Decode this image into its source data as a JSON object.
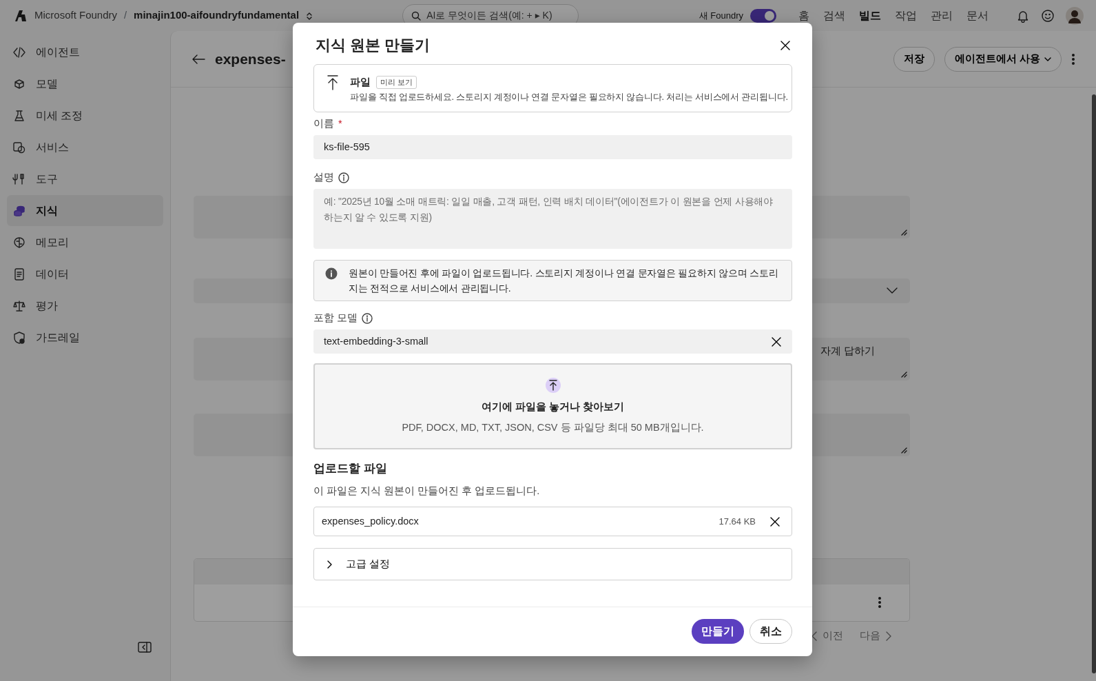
{
  "top_bar": {
    "brand": "Microsoft Foundry",
    "separator": "/",
    "project": "minajin100-aifoundryfundamental",
    "search": {
      "placeholder": "AI로 무엇이든 검색(예: + ▸ K)"
    },
    "new_foundry_toggle": {
      "label": "새 Foundry",
      "on": true
    },
    "nav": [
      {
        "label": "홈",
        "selected": false
      },
      {
        "label": "검색",
        "selected": false
      },
      {
        "label": "빌드",
        "selected": true
      },
      {
        "label": "작업",
        "selected": false
      },
      {
        "label": "관리",
        "selected": false
      },
      {
        "label": "문서",
        "selected": false
      }
    ]
  },
  "sidebar": {
    "items": [
      {
        "label": "에이전트",
        "selected": false
      },
      {
        "label": "모델",
        "selected": false
      },
      {
        "label": "미세 조정",
        "selected": false
      },
      {
        "label": "서비스",
        "selected": false
      },
      {
        "label": "도구",
        "selected": false
      },
      {
        "label": "지식",
        "selected": true
      },
      {
        "label": "메모리",
        "selected": false
      },
      {
        "label": "데이터",
        "selected": false
      },
      {
        "label": "평가",
        "selected": false
      },
      {
        "label": "가드레일",
        "selected": false
      }
    ]
  },
  "page": {
    "title": "expenses-",
    "buttons": [
      "저장",
      "에이전트에서 사용"
    ],
    "visible_field_text": "자계 답하기",
    "pagination": {
      "previous": "이전",
      "next": "다음"
    }
  },
  "dialog": {
    "title": "지식 원본 만들기",
    "source_type": {
      "title": "파일",
      "badge": "미리 보기",
      "description": "파일을 직접 업로드하세요. 스토리지 계정이나 연결 문자열은 필요하지 않습니다. 처리는 서비스에서 관리됩니다."
    },
    "name_field": {
      "label": "이름",
      "required": true,
      "required_mark": "*",
      "value": "ks-file-595"
    },
    "description_field": {
      "label": "설명",
      "placeholder": "예: \"2025년 10월 소매 매트릭: 일일 매출, 고객 패턴, 인력 배치 데이터\"(에이전트가 이 원본을 언제 사용해야 하는지 알 수 있도록 지원)"
    },
    "info": "원본이 만들어진 후에 파일이 업로드됩니다. 스토리지 계정이나 연결 문자열은 필요하지 않으며 스토리지는 전적으로 서비스에서 관리됩니다.",
    "embedding_model": {
      "label": "포함 모델",
      "value": "text-embedding-3-small"
    },
    "dropzone": {
      "title": "여기에 파일을 놓거나 찾아보기",
      "hint": "PDF, DOCX, MD, TXT, JSON, CSV 등 파일당 최대 50 MB개입니다."
    },
    "files_heading": "업로드할 파일",
    "files_note": "이 파일은 지식 원본이 만들어진 후 업로드됩니다.",
    "files": [
      {
        "name": "expenses_policy.docx",
        "size": "17.64 KB"
      }
    ],
    "advanced_settings": {
      "label": "고급 설정",
      "expanded": false
    },
    "buttons": [
      {
        "label": "만들기",
        "kind": "primary"
      },
      {
        "label": "취소",
        "kind": "secondary"
      }
    ]
  }
}
